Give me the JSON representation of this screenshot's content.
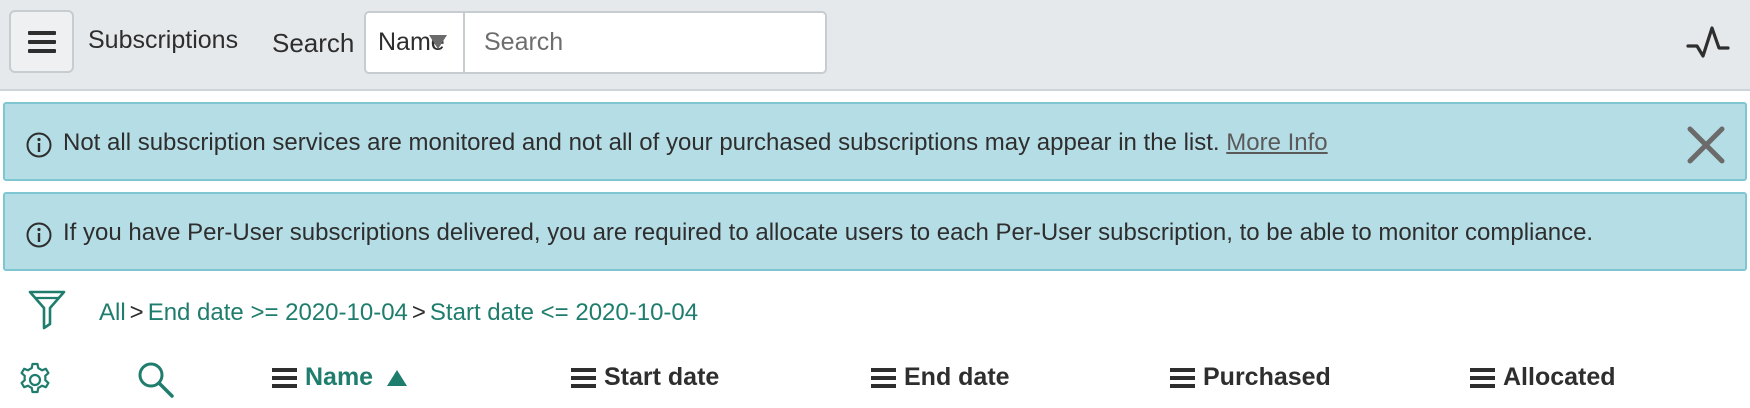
{
  "header": {
    "title": "Subscriptions",
    "search_label": "Search",
    "search_field": "Name",
    "search_placeholder": "Search"
  },
  "alerts": [
    {
      "message": "Not all subscription services are monitored and not all of your purchased subscriptions may appear in the list.",
      "link_text": "More Info"
    },
    {
      "message": "If you have Per-User subscriptions delivered, you are required to allocate users to each Per-User subscription, to be able to monitor compliance."
    }
  ],
  "breadcrumb": {
    "items": [
      "All",
      "End date >= 2020-10-04",
      "Start date <= 2020-10-04"
    ],
    "separator": ">"
  },
  "columns": [
    "Name",
    "Start date",
    "End date",
    "Purchased",
    "Allocated"
  ],
  "sort": {
    "column": "Name",
    "direction": "ascending"
  },
  "colors": {
    "accent": "#1f7d6d",
    "alert_bg": "#b5dde5",
    "alert_border": "#7fc6d2",
    "header_bg": "#e6e9ec"
  },
  "icons": [
    "hamburger-menu-icon",
    "activity-pulse-icon",
    "info-icon",
    "close-icon",
    "filter-funnel-icon",
    "gear-icon",
    "search-icon",
    "column-menu-icon",
    "sort-ascending-icon"
  ]
}
